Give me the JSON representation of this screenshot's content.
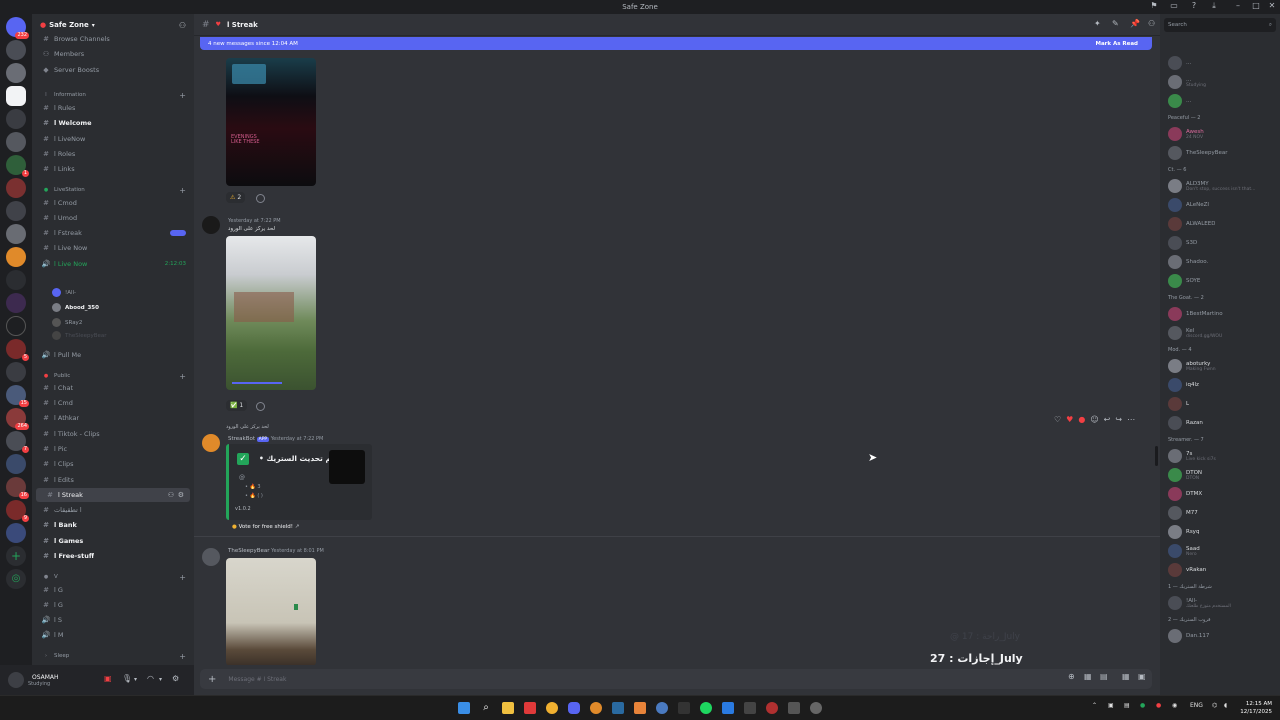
{
  "window": {
    "title": "Safe Zone"
  },
  "server": {
    "name": "Safe Zone"
  },
  "sidebar": {
    "top_items": [
      {
        "icon": "hash-list-icon",
        "label": "Browse Channels"
      },
      {
        "icon": "members-icon",
        "label": "Members"
      },
      {
        "icon": "boost-icon",
        "label": "Server Boosts"
      }
    ],
    "categories": {
      "information": "Information",
      "livestation": "LiveStation",
      "public": "Public",
      "v": "V",
      "sleep": "Sleep"
    },
    "channels": [
      {
        "label": "ا Rules"
      },
      {
        "label": "ا Welcome"
      },
      {
        "label": "ا LiveNow"
      },
      {
        "label": "ا Roles"
      },
      {
        "label": "ا Links"
      },
      {
        "label": "ا Cmod"
      },
      {
        "label": "ا Umod"
      },
      {
        "label": "ا Fstreak"
      },
      {
        "label": "ا Live Now"
      },
      {
        "label": "ا Live Now",
        "time": "2:12:03"
      },
      {
        "label": "ا Pull Me"
      },
      {
        "label": "ا Chat"
      },
      {
        "label": "ا Cmd"
      },
      {
        "label": "ا Athkar"
      },
      {
        "label": "ا Tiktok - Clips"
      },
      {
        "label": "ا Pic"
      },
      {
        "label": "ا Clips"
      },
      {
        "label": "ا Edits"
      },
      {
        "label": "ا Streak"
      },
      {
        "label": "ا تطقيقات"
      },
      {
        "label": "ا Bank"
      },
      {
        "label": "ا Games"
      },
      {
        "label": "ا Free-stuff"
      },
      {
        "label": "ا G"
      },
      {
        "label": "ا G"
      },
      {
        "label": "ا S"
      },
      {
        "label": "ا M"
      }
    ],
    "voice_users": [
      "!All-",
      "Abood_350",
      "SRay2",
      "TheSleepyBear"
    ]
  },
  "user_panel": {
    "name": "OSAMAH",
    "status": "Studying"
  },
  "chat": {
    "channel_name": "ا Streak",
    "new_messages": "4 new messages since 12:04 AM",
    "mark_as_read": "Mark As Read",
    "reactions": [
      {
        "emoji": "⚠",
        "count": "2"
      },
      {
        "emoji": "✅",
        "count": "1"
      }
    ],
    "message_meta_1": "Yesterday at 7:22 PM",
    "message_text_1": "لحد يركز على الورود",
    "reply_preview": "لحد يركز على الورود",
    "bot_name": "StreakBot",
    "bot_tag": "APP",
    "bot_time": "Yesterday at 7:22 PM",
    "embed_title": "تم تحديث الستريك •",
    "embed_version": "v1.0.2",
    "vote_label": "Vote for free shield!",
    "message_meta_3_name": "TheSleepyBear",
    "message_meta_3_time": "Yesterday at 8:01 PM",
    "overlay_text": "إجازات : 27_July",
    "overlay_faint": "@ راحة : 17_July",
    "composer_placeholder": "Message # ا Streak"
  },
  "members": {
    "search_placeholder": "Search",
    "groups": [
      {
        "header": "",
        "items": [
          {
            "name": "...",
            "sub": "",
            "color": "#949ba4"
          },
          {
            "name": "...",
            "sub": "Studying",
            "color": "#949ba4"
          },
          {
            "name": "...",
            "sub": "",
            "color": "#949ba4"
          }
        ]
      },
      {
        "header": "Peaceful — 2",
        "items": [
          {
            "name": "Awesh",
            "sub": "24 NOV",
            "color": "#e06c9f"
          },
          {
            "name": "TheSleepyBear",
            "sub": "",
            "color": "#949ba4"
          }
        ]
      },
      {
        "header": "Ct. — 6",
        "items": [
          {
            "name": "ALD3MY",
            "sub": "Don't stop, success isn't that...",
            "color": "#949ba4"
          },
          {
            "name": "ALeNeZI",
            "sub": "",
            "color": "#949ba4"
          },
          {
            "name": "ALWALEED",
            "sub": "",
            "color": "#949ba4"
          },
          {
            "name": "S3D",
            "sub": "",
            "color": "#949ba4"
          },
          {
            "name": "Shadoo.",
            "sub": "",
            "color": "#949ba4"
          },
          {
            "name": "SOYE",
            "sub": "",
            "color": "#949ba4"
          }
        ]
      },
      {
        "header": "The Goat. — 2",
        "items": [
          {
            "name": "1BestMartino",
            "sub": "",
            "color": "#949ba4"
          },
          {
            "name": "Kel",
            "sub": "discord.gg/WOU",
            "color": "#949ba4"
          }
        ]
      },
      {
        "header": "Mod. — 4",
        "items": [
          {
            "name": "aboturky",
            "sub": "Making Fwnn",
            "color": "#dbdee1"
          },
          {
            "name": "iq4lz",
            "sub": "",
            "color": "#dbdee1"
          },
          {
            "name": "L",
            "sub": "",
            "color": "#dbdee1"
          },
          {
            "name": "Razan",
            "sub": "",
            "color": "#dbdee1"
          }
        ]
      },
      {
        "header": "Streamer. — 7",
        "items": [
          {
            "name": "7s",
            "sub": "Live kick si7s",
            "color": "#dbdee1"
          },
          {
            "name": "DTON",
            "sub": "DTON",
            "color": "#dbdee1"
          },
          {
            "name": "DTMX",
            "sub": "",
            "color": "#dbdee1"
          },
          {
            "name": "M77",
            "sub": "",
            "color": "#dbdee1"
          },
          {
            "name": "Rsyq",
            "sub": "",
            "color": "#dbdee1"
          },
          {
            "name": "Saad",
            "sub": "Nero",
            "color": "#dbdee1"
          },
          {
            "name": "vRakan",
            "sub": "",
            "color": "#dbdee1"
          }
        ]
      },
      {
        "header": "شرطة الستريك — 1",
        "items": [
          {
            "name": "!All-",
            "sub": "المستخدم متوزع طلعتك",
            "color": "#949ba4"
          }
        ]
      },
      {
        "header": "قروب الستريك — 2",
        "items": [
          {
            "name": "Dan.117",
            "sub": "",
            "color": "#949ba4"
          }
        ]
      }
    ]
  },
  "taskbar": {
    "lang": "ENG",
    "time": "12:15 AM",
    "date": "12/17/2025"
  },
  "colors": {
    "blurple": "#5865f2",
    "green": "#23a55a",
    "red": "#f23f43",
    "bg_chat": "#313338",
    "bg_sidebar": "#2b2d31"
  }
}
